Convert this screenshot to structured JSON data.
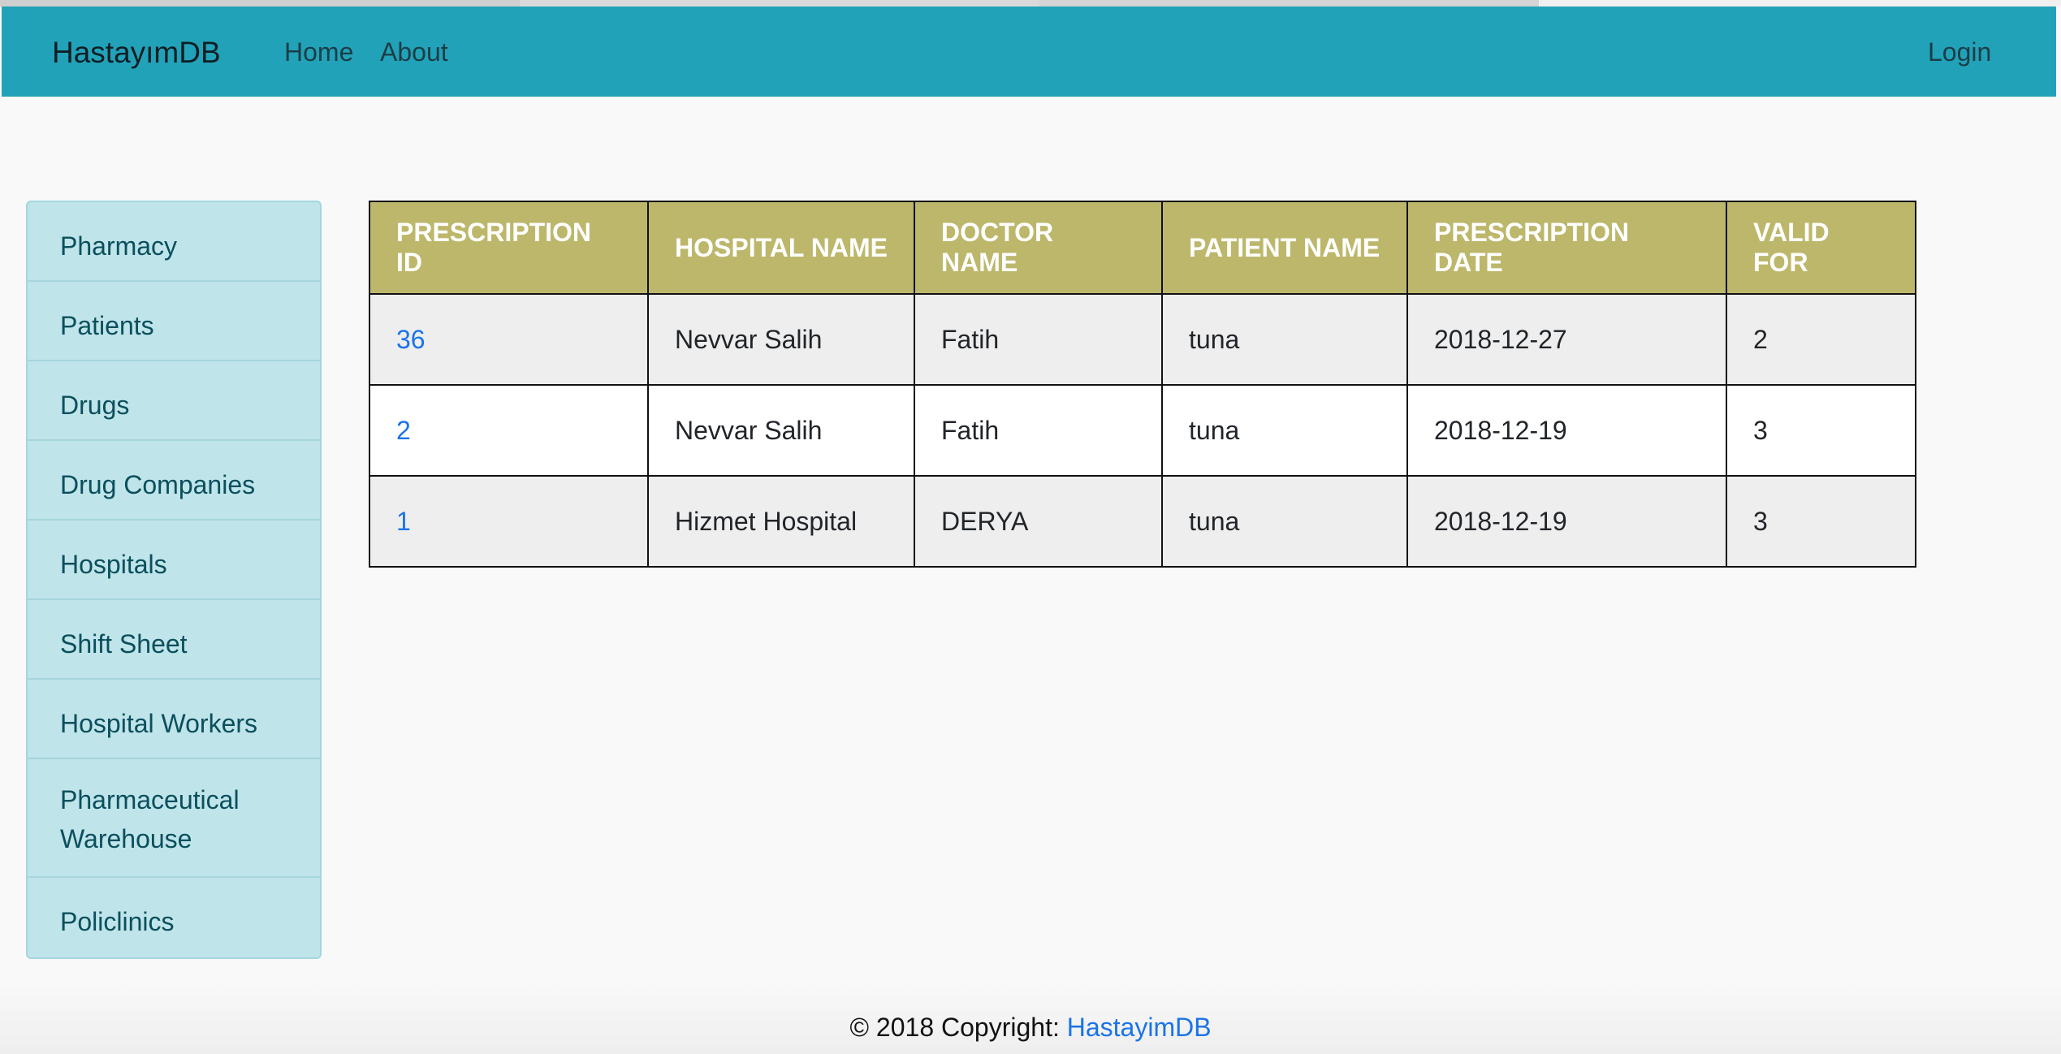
{
  "navbar": {
    "brand": "HastayımDB",
    "links": [
      "Home",
      "About"
    ],
    "login": "Login",
    "color": "#22a2b8"
  },
  "sidebar": {
    "items": [
      {
        "label": "Pharmacy"
      },
      {
        "label": "Patients"
      },
      {
        "label": "Drugs"
      },
      {
        "label": "Drug Companies"
      },
      {
        "label": "Hospitals"
      },
      {
        "label": "Shift Sheet"
      },
      {
        "label": "Hospital Workers"
      },
      {
        "label": "Pharmaceutical Warehouse"
      },
      {
        "label": "Policlinics"
      }
    ]
  },
  "table": {
    "header_color": "#bdb76b",
    "columns": [
      "PRESCRIPTION ID",
      "HOSPITAL NAME",
      "DOCTOR NAME",
      "PATIENT NAME",
      "PRESCRIPTION DATE",
      "VALID FOR"
    ],
    "rows": [
      [
        "36",
        "Nevvar Salih",
        "Fatih",
        "tuna",
        "2018-12-27",
        "2"
      ],
      [
        "2",
        "Nevvar Salih",
        "Fatih",
        "tuna",
        "2018-12-19",
        "3"
      ],
      [
        "1",
        "Hizmet Hospital",
        "DERYA",
        "tuna",
        "2018-12-19",
        "3"
      ]
    ]
  },
  "footer": {
    "text": "© 2018 Copyright: ",
    "link": "HastayimDB"
  }
}
